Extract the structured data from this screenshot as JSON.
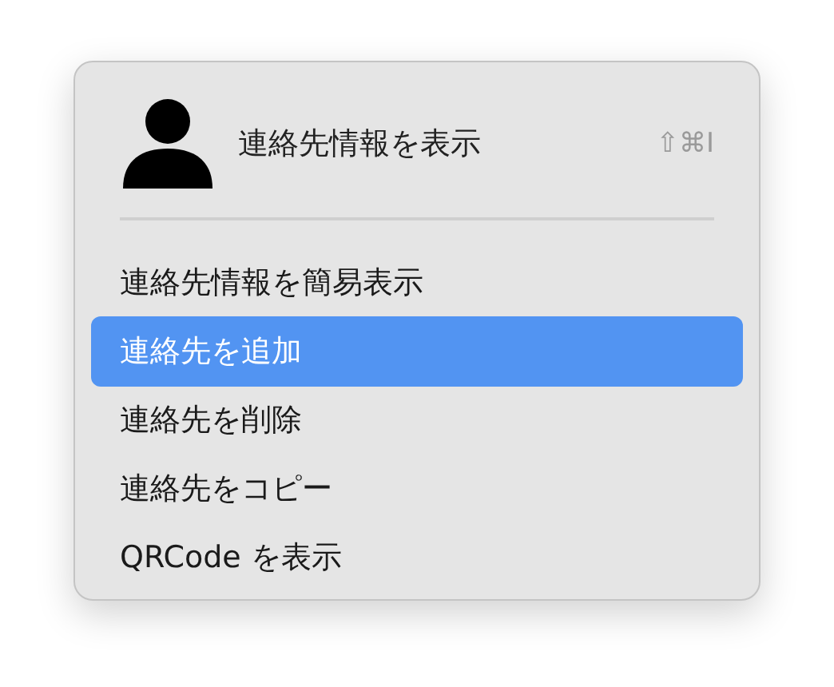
{
  "header": {
    "label": "連絡先情報を表示",
    "shortcut": "⇧⌘I"
  },
  "items": [
    {
      "label": "連絡先情報を簡易表示",
      "selected": false
    },
    {
      "label": "連絡先を追加",
      "selected": true
    },
    {
      "label": "連絡先を削除",
      "selected": false
    },
    {
      "label": "連絡先をコピー",
      "selected": false
    },
    {
      "label": "QRCode を表示",
      "selected": false
    }
  ]
}
